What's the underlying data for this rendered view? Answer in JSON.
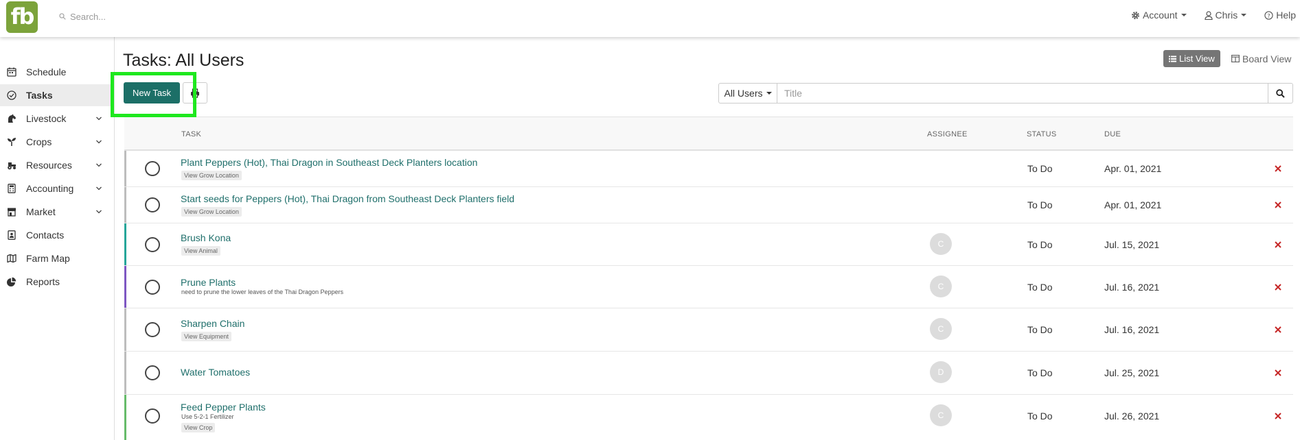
{
  "header": {
    "logo_text": "fb",
    "search_placeholder": "Search...",
    "nav": {
      "account": "Account",
      "user": "Chris",
      "help": "Help"
    }
  },
  "sidebar": {
    "items": [
      {
        "label": "Schedule",
        "icon": "calendar-icon"
      },
      {
        "label": "Tasks",
        "icon": "check-circle-icon",
        "active": true
      },
      {
        "label": "Livestock",
        "icon": "horse-icon",
        "expandable": true
      },
      {
        "label": "Crops",
        "icon": "seedling-icon",
        "expandable": true
      },
      {
        "label": "Resources",
        "icon": "tractor-icon",
        "expandable": true
      },
      {
        "label": "Accounting",
        "icon": "calculator-icon",
        "expandable": true
      },
      {
        "label": "Market",
        "icon": "store-icon",
        "expandable": true
      },
      {
        "label": "Contacts",
        "icon": "address-book-icon"
      },
      {
        "label": "Farm Map",
        "icon": "map-icon"
      },
      {
        "label": "Reports",
        "icon": "pie-chart-icon"
      }
    ]
  },
  "main": {
    "title": "Tasks: All Users",
    "view_toggle": {
      "list": "List View",
      "board": "Board View"
    },
    "new_task_label": "New Task",
    "filter": {
      "users_label": "All Users",
      "title_placeholder": "Title"
    },
    "columns": {
      "task": "TASK",
      "assignee": "ASSIGNEE",
      "status": "STATUS",
      "due": "DUE"
    },
    "tasks": [
      {
        "title": "Plant Peppers (Hot), Thai Dragon in Southeast Deck Planters location",
        "tag": "View Grow Location",
        "desc": "",
        "assignee": "",
        "status": "To Do",
        "due": "Apr. 01, 2021",
        "color": "#bdbdbd"
      },
      {
        "title": "Start seeds for Peppers (Hot), Thai Dragon from Southeast Deck Planters field",
        "tag": "View Grow Location",
        "desc": "",
        "assignee": "",
        "status": "To Do",
        "due": "Apr. 01, 2021",
        "color": "#bdbdbd"
      },
      {
        "title": "Brush Kona",
        "tag": "View Animal",
        "desc": "",
        "assignee": "C",
        "status": "To Do",
        "due": "Jul. 15, 2021",
        "color": "#26a69a"
      },
      {
        "title": "Prune Plants",
        "tag": "",
        "desc": "need to prune the lower leaves of the Thai Dragon Peppers",
        "assignee": "C",
        "status": "To Do",
        "due": "Jul. 16, 2021",
        "color": "#7e57c2"
      },
      {
        "title": "Sharpen Chain",
        "tag": "View Equipment",
        "desc": "",
        "assignee": "C",
        "status": "To Do",
        "due": "Jul. 16, 2021",
        "color": "#bdbdbd"
      },
      {
        "title": "Water Tomatoes",
        "tag": "",
        "desc": "",
        "assignee": "D",
        "status": "To Do",
        "due": "Jul. 25, 2021",
        "color": "#bdbdbd"
      },
      {
        "title": "Feed Pepper Plants",
        "tag": "View Crop",
        "desc": "Use 5-2-1 Fertilizer",
        "assignee": "C",
        "status": "To Do",
        "due": "Jul. 26, 2021",
        "color": "#66bb6a"
      }
    ]
  },
  "colors": {
    "brand": "#7ca33b",
    "accent": "#1c6f67",
    "link": "#1f6f6b",
    "delete": "#c62828",
    "highlight": "#1ee81e"
  }
}
